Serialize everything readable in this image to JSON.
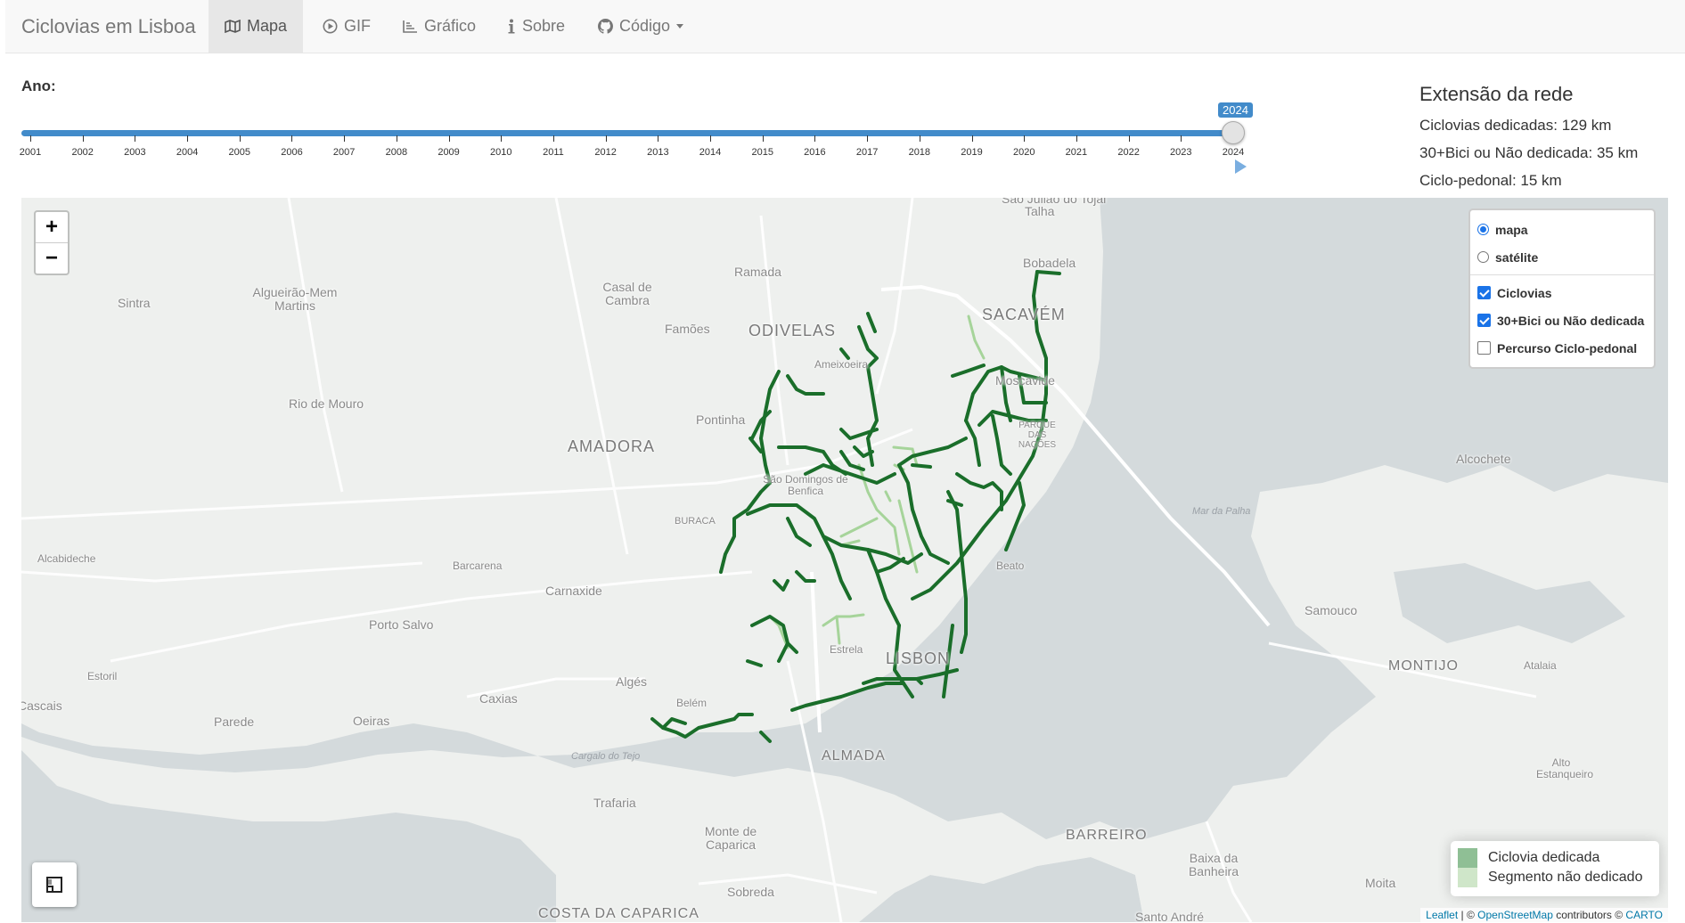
{
  "navbar": {
    "brand": "Ciclovias em Lisboa",
    "tabs": [
      {
        "label": "Mapa",
        "icon": "map-icon",
        "active": true
      },
      {
        "label": "GIF",
        "icon": "play-circle-icon",
        "active": false
      },
      {
        "label": "Gráfico",
        "icon": "line-chart-icon",
        "active": false
      },
      {
        "label": "Sobre",
        "icon": "info-icon",
        "active": false
      },
      {
        "label": "Código",
        "icon": "github-icon",
        "active": false
      }
    ]
  },
  "controls": {
    "year_label": "Ano:",
    "slider": {
      "min": 2001,
      "max": 2024,
      "value": 2024,
      "value_label": "2024",
      "tick_labels": [
        "2001",
        "2002",
        "2003",
        "2004",
        "2005",
        "2006",
        "2007",
        "2008",
        "2009",
        "2010",
        "2011",
        "2012",
        "2013",
        "2014",
        "2015",
        "2016",
        "2017",
        "2018",
        "2019",
        "2020",
        "2021",
        "2022",
        "2023",
        "2024"
      ]
    }
  },
  "stats": {
    "title": "Extensão da rede",
    "dedicated": "Ciclovias dedicadas: 129 km",
    "shared": "30+Bici ou Não dedicada: 35 km",
    "pedonal": "Ciclo-pedonal: 15 km"
  },
  "map": {
    "zoom_in": "+",
    "zoom_out": "−",
    "layers": {
      "base": [
        {
          "label": "mapa",
          "selected": true
        },
        {
          "label": "satélite",
          "selected": false
        }
      ],
      "overlays": [
        {
          "label": "Ciclovias",
          "checked": true
        },
        {
          "label": "30+Bici ou Não dedicada",
          "checked": true
        },
        {
          "label": "Percurso Ciclo-pedonal",
          "checked": false
        }
      ]
    },
    "legend": [
      {
        "label": "Ciclovia dedicada",
        "color": "#8fbf95"
      },
      {
        "label": "Segmento não dedicado",
        "color": "#cfe6c9"
      }
    ],
    "attribution": {
      "leaflet": "Leaflet",
      "sep1": " | © ",
      "osm": "OpenStreetMap",
      "sep2": " contributors © ",
      "carto": "CARTO"
    },
    "places": [
      "São Julião do Tojal",
      "Talha",
      "Bobadela",
      "Sintra",
      "Algueirão-Mem Martins",
      "Casal de Cambra",
      "Ramada",
      "Famões",
      "ODIVELAS",
      "SACAVÉM",
      "Moscavide",
      "Ameixoeira",
      "Rio de Mouro",
      "Pontinha",
      "AMADORA",
      "PARQUE DAS NAÇÕES",
      "Alcochete",
      "São Domingos de Benfica",
      "BURACA",
      "Mar da Palha",
      "Alcabideche",
      "Barcarena",
      "Carnaxide",
      "Beato",
      "Porto Salvo",
      "Samouco",
      "Estoril",
      "Estrela",
      "LISBON",
      "Algés",
      "MONTIJO",
      "Atalaia",
      "Caxias",
      "Cascais",
      "Belém",
      "Parede",
      "Oeiras",
      "Cargalo do Tejo",
      "ALMADA",
      "Alto Estanqueiro",
      "Trafaria",
      "Monte de Caparica",
      "BARREIRO",
      "Baixa da Banheira",
      "Sobreda",
      "Moita",
      "COSTA DA CAPARICA",
      "Santo André"
    ]
  },
  "colors": {
    "accent": "#428bca",
    "route_dedicated": "#1a6e2a",
    "route_shared": "#a6d49a",
    "water": "#d4dadc",
    "land": "#eef0ee"
  }
}
